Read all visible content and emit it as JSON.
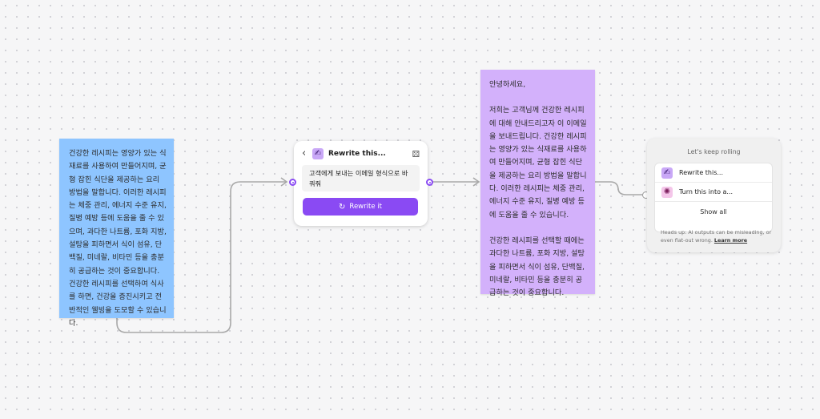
{
  "blue_sticky": {
    "text": "건강한 레시피는 영양가 있는 식재료를 사용하여 만들어지며, 균형 잡힌 식단을 제공하는 요리 방법을 말합니다. 이러한 레시피는 체중 관리, 에너지 수준 유지, 질병 예방 등에 도움을 줄 수 있으며, 과다한 나트륨, 포화 지방, 설탕을 피하면서 식이 섬유, 단백질, 미네랄, 비타민 등을 충분히 공급하는 것이 중요합니다. 건강한 레시피를 선택하여 식사를 하면, 건강을 증진시키고 전반적인 웰빙을 도모할 수 있습니다."
  },
  "rewrite_card": {
    "title": "Rewrite this...",
    "prompt": "고객에게 보내는 이메일 형식으로 바꿔줘",
    "button_label": "Rewrite it",
    "back_icon": "chevron-left-icon",
    "dice_icon": "dice-icon",
    "tile_icon": "rewrite-icon"
  },
  "purple_sticky": {
    "greeting": "안녕하세요,",
    "paragraph_1": "저희는 고객님께 건강한 레시피에 대해 안내드리고자 이 이메일을 보내드립니다. 건강한 레시피는 영양가 있는 식재료를 사용하여 만들어지며, 균형 잡힌 식단을 제공하는 요리 방법을 말합니다. 이러한 레시피는 체중 관리, 에너지 수준 유지, 질병 예방 등에 도움을 줄 수 있습니다.",
    "paragraph_2": "건강한 레시피를 선택할 때에는 과다한 나트륨, 포화 지방, 설탕을 피하면서 식이 섬유, 단백질, 미네랄, 비타민 등을 충분히 공급하는 것이 중요합니다."
  },
  "next_panel": {
    "title": "Let's keep rolling",
    "items": [
      {
        "label": "Rewrite this...",
        "icon": "rewrite-icon"
      },
      {
        "label": "Turn this into a...",
        "icon": "transform-icon"
      }
    ],
    "show_all": "Show all",
    "note": "Heads up: AI outputs can be misleading, or even flat-out wrong.",
    "note_link": "Learn more"
  },
  "colors": {
    "accent": "#8a4af3",
    "blue_sticky": "#8ec5ff",
    "purple_sticky": "#d3b1fb",
    "connector": "#a8a8a8"
  }
}
